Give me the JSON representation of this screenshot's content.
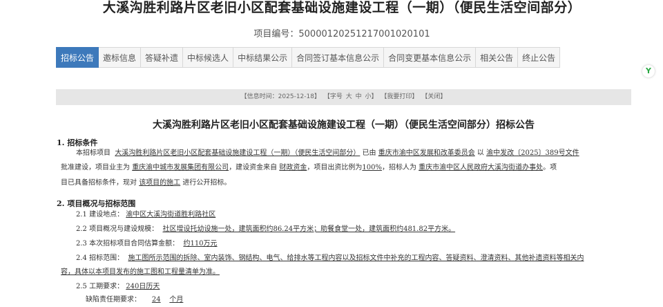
{
  "page": {
    "title": "大溪沟胜利路片区老旧小区配套基础设施建设工程（一期）（便民生活空间部分）",
    "project_no_label": "项目编号：",
    "project_no": "5000012025121700102010​1"
  },
  "tabs": [
    {
      "label": "招标公告",
      "active": true
    },
    {
      "label": "邀标信息"
    },
    {
      "label": "答疑补遗"
    },
    {
      "label": "中标候选人"
    },
    {
      "label": "中标结果公示"
    },
    {
      "label": "合同签订基本信息公示"
    },
    {
      "label": "合同变更基本信息公示"
    },
    {
      "label": "相关公告"
    },
    {
      "label": "终止公告"
    }
  ],
  "side_badge": "Y",
  "infobar": {
    "info_time": "【信息时间：2025-12-18】",
    "font_prefix": "【字号",
    "font_large": "大",
    "font_medium": "中",
    "font_small": "小】",
    "print": "【我要打印】",
    "close": "【关闭】"
  },
  "doc": {
    "title": "大溪沟胜利路片区老旧小区配套基础设施建设工程（一期）（便民生活空间部分）招标公告",
    "s1_head": "1. 招标条件",
    "s1_l1_a": "本招标项目",
    "s1_l1_project": "大溪沟胜利路片区老旧小区配套基础设施建设工程（一期）（便民生活空间部分）",
    "s1_l1_b": "已由",
    "s1_l1_authority": "重庆市渝中区发展和改革委员会",
    "s1_l1_c": "以",
    "s1_l1_doc": "渝中发改〔2025〕389号文件",
    "s1_l2_a": "批准建设，项目业主为",
    "s1_l2_owner": "重庆渝中城市发展集团有限公司",
    "s1_l2_b": "，建设资金来自",
    "s1_l2_fund": "财政资金",
    "s1_l2_c": "，项目出资比例为",
    "s1_l2_ratio": "100%",
    "s1_l2_d": "，招标人为",
    "s1_l2_tenderer": "重庆市渝中区人民政府大溪沟街道办事处",
    "s1_l2_e": "。项",
    "s1_l3_a": "目已具备招标条件，现对",
    "s1_l3_obj": "该项目的施工",
    "s1_l3_b": "进行公开招标。",
    "s2_head": "2. 项目概况与招标范围",
    "s21_label": "2.1 建设地点：",
    "s21_value": "渝中区大溪沟街道胜利路社区",
    "s22_label": "2.2 项目概况与建设规模：",
    "s22_value": "社区增设托幼设施一处，建筑面积约86.24平方米；助餐食堂一处，建筑面积约481.82平方米。",
    "s23_label": "2.3 本次招标项目合同估算金额：",
    "s23_value": "约110万元",
    "s24_label": "2.4 招标范围：",
    "s24_value1": "施工图所示范围的拆除、室内装饰、钢结构、电气、给排水等工程内容以及招标文件中补充的工程内容、答疑资料、澄清资料、其他补遗资料等相关内",
    "s24_value2": "容，具体以本项目发布的施工图和工程量清单为准。",
    "s25_label": "2.5 工期要求：",
    "s25_value": "240日历天",
    "s26_label": "缺陷责任期要求：",
    "s26_value": "24",
    "s26_unit": "个月"
  }
}
